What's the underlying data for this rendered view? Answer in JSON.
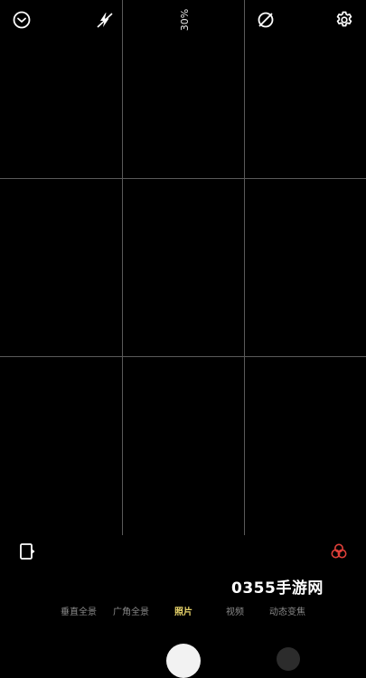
{
  "top_bar": {
    "timer_icon": "timer-icon",
    "flash_icon": "flash-off-icon",
    "zoom_level": "30%",
    "filter_off_icon": "filter-off-icon",
    "settings_icon": "gear-icon"
  },
  "side_controls": {
    "switch_camera_icon": "switch-camera-icon",
    "beauty_icon": "beauty-effects-icon"
  },
  "watermark": "0355手游网",
  "modes": [
    {
      "label": "垂直全景",
      "active": false
    },
    {
      "label": "广角全景",
      "active": false
    },
    {
      "label": "照片",
      "active": true
    },
    {
      "label": "视频",
      "active": false
    },
    {
      "label": "动态变焦",
      "active": false
    }
  ],
  "colors": {
    "active_mode": "#e6d26a",
    "inactive_mode": "#8a8a8a",
    "beauty_icon": "#e0403a",
    "grid": "#5a5a5a"
  }
}
